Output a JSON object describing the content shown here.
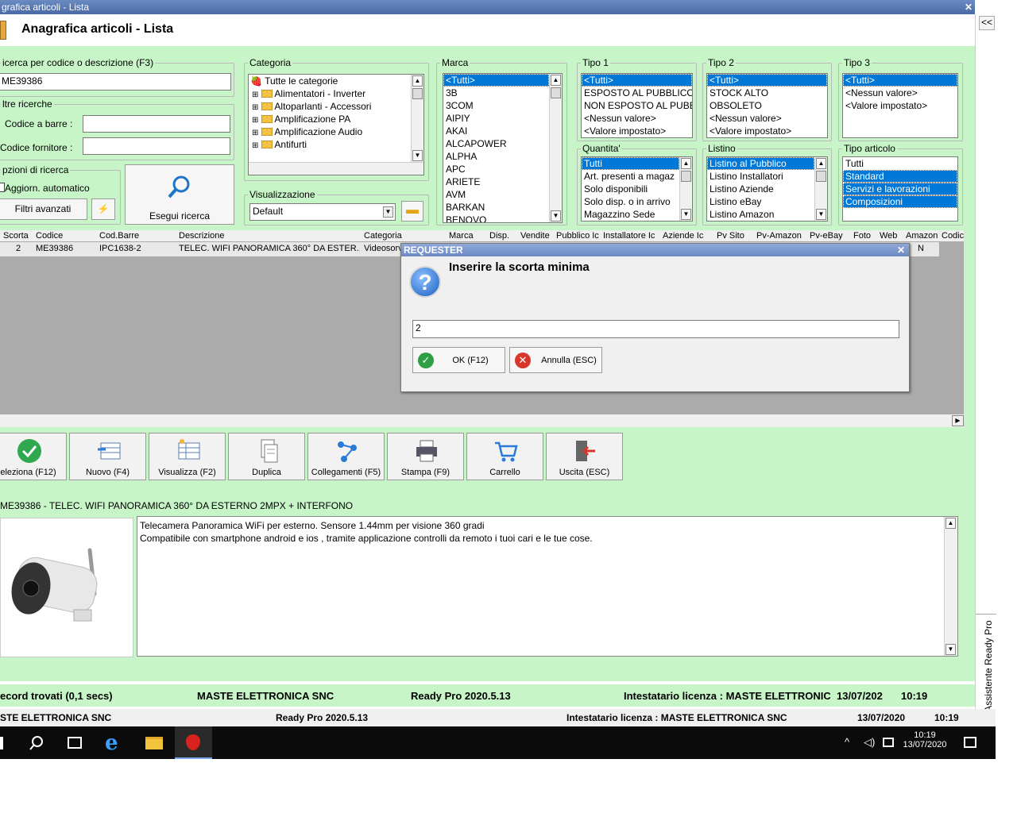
{
  "window": {
    "title": "grafica articoli  - Lista",
    "header": "Anagrafica articoli  - Lista",
    "close": "✕",
    "collapse": "<<"
  },
  "assistant": "Assistente Ready Pro",
  "search": {
    "legend": "icerca per codice o descrizione (F3)",
    "value": "ME39386"
  },
  "other": {
    "legend": "ltre ricerche",
    "barcode_label": "Codice a barre :",
    "supplier_label": "Codice fornitore :",
    "barcode_value": "",
    "supplier_value": ""
  },
  "options": {
    "legend": "pzioni di ricerca",
    "auto_label": "Aggiorn. automatico",
    "advanced": "Filtri avanzati",
    "search_btn": "Esegui ricerca"
  },
  "categoria": {
    "legend": "Categoria",
    "items": [
      "Tutte le categorie",
      "Alimentatori - Inverter",
      "Altoparlanti - Accessori",
      "Amplificazione PA",
      "Amplificazione Audio",
      "Antifurti"
    ]
  },
  "visualizzazione": {
    "legend": "Visualizzazione",
    "value": "Default"
  },
  "marca": {
    "legend": "Marca",
    "items": [
      "<Tutti>",
      "3B",
      "3COM",
      "AIPIY",
      "AKAI",
      "ALCAPOWER",
      "ALPHA",
      "APC",
      "ARIETE",
      "AVM",
      "BARKAN",
      "BENOVO"
    ]
  },
  "tipo1": {
    "legend": "Tipo 1",
    "items": [
      "<Tutti>",
      "ESPOSTO AL PUBBLICO",
      "NON ESPOSTO AL PUBB",
      "<Nessun valore>",
      "<Valore impostato>"
    ]
  },
  "tipo2": {
    "legend": "Tipo 2",
    "items": [
      "<Tutti>",
      "STOCK ALTO",
      "OBSOLETO",
      "<Nessun valore>",
      "<Valore impostato>"
    ]
  },
  "tipo3": {
    "legend": "Tipo 3",
    "items": [
      "<Tutti>",
      "<Nessun valore>",
      "<Valore impostato>"
    ]
  },
  "quantita": {
    "legend": "Quantita'",
    "items": [
      "Tutti",
      "Art. presenti a magaz",
      "Solo disponibili",
      "Solo disp. o in arrivo",
      "Magazzino Sede"
    ]
  },
  "listino": {
    "legend": "Listino",
    "items": [
      "Listino al Pubblico",
      "Listino Installatori",
      "Listino Aziende",
      "Listino eBay",
      "Listino Amazon"
    ]
  },
  "tipo_articolo": {
    "legend": "Tipo articolo",
    "items": [
      "Tutti",
      "Standard",
      "Servizi e lavorazioni",
      "Composizioni"
    ]
  },
  "grid": {
    "headers": [
      "Scorta",
      "Codice",
      "Cod.Barre",
      "Descrizione",
      "Categoria",
      "Marca",
      "Disp.",
      "Vendite",
      "Pubblico Ic",
      "Installatore Ic",
      "Aziende Ic",
      "Pv Sito",
      "Pv-Amazon",
      "Pv-eBay",
      "Foto",
      "Web",
      "Amazon",
      "Codic"
    ],
    "row": {
      "scorta": "2",
      "codice": "ME39386",
      "barre": "IPC1638-2",
      "descrizione": "TELEC. WIFI PANORAMICA 360° DA ESTER...",
      "categoria": "Videosorv",
      "amazon": "N"
    }
  },
  "toolbar": [
    "eleziona (F12)",
    "Nuovo (F4)",
    "Visualizza (F2)",
    "Duplica",
    "Collegamenti (F5)",
    "Stampa (F9)",
    "Carrello",
    "Uscita (ESC)"
  ],
  "detail": {
    "title": "ME39386 - TELEC. WIFI PANORAMICA 360° DA ESTERNO 2MPX + INTERFONO",
    "line1": "Telecamera Panoramica WiFi per esterno. Sensore 1.44mm per visione 360 gradi",
    "line2": "Compatibile con smartphone android e ios , tramite applicazione controlli da remoto i tuoi cari e le tue cose."
  },
  "status1": {
    "found": "ecord trovati (0,1 secs)",
    "company": "MASTE ELETTRONICA SNC",
    "version": "Ready Pro 2020.5.13",
    "license": "Intestatario licenza : MASTE ELETTRONIC",
    "date": "13/07/202",
    "time": "10:19"
  },
  "status2": {
    "company": "STE ELETTRONICA SNC",
    "version": "Ready Pro 2020.5.13",
    "license": "Intestatario licenza : MASTE ELETTRONICA SNC",
    "date": "13/07/2020",
    "time": "10:19"
  },
  "taskbar": {
    "time": "10:19",
    "date": "13/07/2020"
  },
  "dialog": {
    "title": "REQUESTER",
    "prompt": "Inserire la scorta minima",
    "value": "2",
    "ok": "OK (F12)",
    "cancel": "Annulla (ESC)"
  }
}
